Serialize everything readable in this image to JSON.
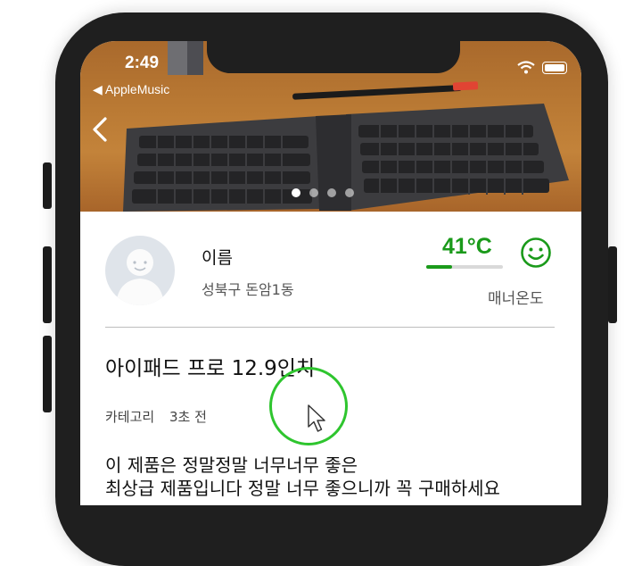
{
  "status_bar": {
    "time": "2:49",
    "back_app": "◀ AppleMusic"
  },
  "photo": {
    "page_count": 4,
    "active_index": 0
  },
  "profile": {
    "name": "이름",
    "location": "성북구 돈암1동",
    "temperature": "41°C",
    "temperature_fill_fraction": 0.34,
    "manner_label": "매너온도",
    "accent_color": "#1a9a1a"
  },
  "product": {
    "title": "아이패드 프로 12.9인치",
    "category": "카테고리",
    "time_ago": "3초 전",
    "description_lines": [
      "이 제품은 정말정말 너무너무 좋은",
      "최상급 제품입니다 정말 너무 좋으니까 꼭 구매하세요"
    ]
  },
  "icons": [
    "back-chevron-icon",
    "wifi-icon",
    "battery-icon",
    "smile-icon",
    "mouse-cursor-icon"
  ]
}
